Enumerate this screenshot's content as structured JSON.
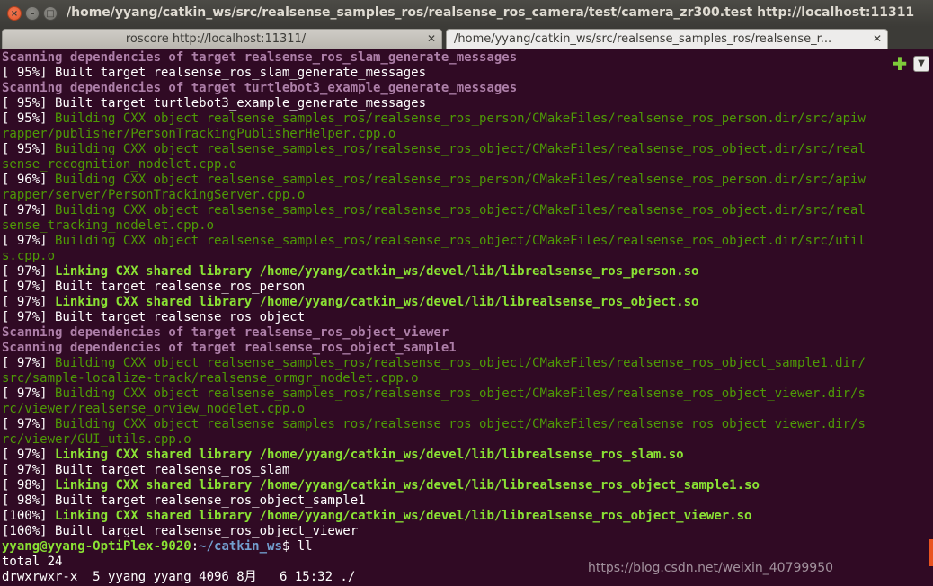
{
  "window": {
    "title": "/home/yyang/catkin_ws/src/realsense_samples_ros/realsense_ros_camera/test/camera_zr300.test http://localhost:11311"
  },
  "tabs": [
    {
      "label": "roscore http://localhost:11311/",
      "active": false
    },
    {
      "label": "/home/yyang/catkin_ws/src/realsense_samples_ros/realsense_r...",
      "active": true
    }
  ],
  "terminal": {
    "lines": [
      {
        "style": "scan",
        "text": "Scanning dependencies of target realsense_ros_slam_generate_messages"
      },
      {
        "style": "plain",
        "text": "[ 95%] Built target realsense_ros_slam_generate_messages"
      },
      {
        "style": "scan",
        "text": "Scanning dependencies of target turtlebot3_example_generate_messages"
      },
      {
        "style": "plain",
        "text": "[ 95%] Built target turtlebot3_example_generate_messages"
      },
      {
        "style": "cxx",
        "pct": "[ 95%] ",
        "text": "Building CXX object realsense_samples_ros/realsense_ros_person/CMakeFiles/realsense_ros_person.dir/src/apiw"
      },
      {
        "style": "cxx",
        "text": "rapper/publisher/PersonTrackingPublisherHelper.cpp.o"
      },
      {
        "style": "cxx",
        "pct": "[ 95%] ",
        "text": "Building CXX object realsense_samples_ros/realsense_ros_object/CMakeFiles/realsense_ros_object.dir/src/real"
      },
      {
        "style": "cxx",
        "text": "sense_recognition_nodelet.cpp.o"
      },
      {
        "style": "cxx",
        "pct": "[ 96%] ",
        "text": "Building CXX object realsense_samples_ros/realsense_ros_person/CMakeFiles/realsense_ros_person.dir/src/apiw"
      },
      {
        "style": "cxx",
        "text": "rapper/server/PersonTrackingServer.cpp.o"
      },
      {
        "style": "cxx",
        "pct": "[ 97%] ",
        "text": "Building CXX object realsense_samples_ros/realsense_ros_object/CMakeFiles/realsense_ros_object.dir/src/real"
      },
      {
        "style": "cxx",
        "text": "sense_tracking_nodelet.cpp.o"
      },
      {
        "style": "cxx",
        "pct": "[ 97%] ",
        "text": "Building CXX object realsense_samples_ros/realsense_ros_object/CMakeFiles/realsense_ros_object.dir/src/util"
      },
      {
        "style": "cxx",
        "text": "s.cpp.o"
      },
      {
        "style": "link",
        "pct": "[ 97%] ",
        "text": "Linking CXX shared library /home/yyang/catkin_ws/devel/lib/librealsense_ros_person.so"
      },
      {
        "style": "plain",
        "text": "[ 97%] Built target realsense_ros_person"
      },
      {
        "style": "link",
        "pct": "[ 97%] ",
        "text": "Linking CXX shared library /home/yyang/catkin_ws/devel/lib/librealsense_ros_object.so"
      },
      {
        "style": "plain",
        "text": "[ 97%] Built target realsense_ros_object"
      },
      {
        "style": "scan",
        "text": "Scanning dependencies of target realsense_ros_object_viewer"
      },
      {
        "style": "scan",
        "text": "Scanning dependencies of target realsense_ros_object_sample1"
      },
      {
        "style": "cxx",
        "pct": "[ 97%] ",
        "text": "Building CXX object realsense_samples_ros/realsense_ros_object/CMakeFiles/realsense_ros_object_sample1.dir/"
      },
      {
        "style": "cxx",
        "text": "src/sample-localize-track/realsense_ormgr_nodelet.cpp.o"
      },
      {
        "style": "cxx",
        "pct": "[ 97%] ",
        "text": "Building CXX object realsense_samples_ros/realsense_ros_object/CMakeFiles/realsense_ros_object_viewer.dir/s"
      },
      {
        "style": "cxx",
        "text": "rc/viewer/realsense_orview_nodelet.cpp.o"
      },
      {
        "style": "cxx",
        "pct": "[ 97%] ",
        "text": "Building CXX object realsense_samples_ros/realsense_ros_object/CMakeFiles/realsense_ros_object_viewer.dir/s"
      },
      {
        "style": "cxx",
        "text": "rc/viewer/GUI_utils.cpp.o"
      },
      {
        "style": "link",
        "pct": "[ 97%] ",
        "text": "Linking CXX shared library /home/yyang/catkin_ws/devel/lib/librealsense_ros_slam.so"
      },
      {
        "style": "plain",
        "text": "[ 97%] Built target realsense_ros_slam"
      },
      {
        "style": "link",
        "pct": "[ 98%] ",
        "text": "Linking CXX shared library /home/yyang/catkin_ws/devel/lib/librealsense_ros_object_sample1.so"
      },
      {
        "style": "plain",
        "text": "[ 98%] Built target realsense_ros_object_sample1"
      },
      {
        "style": "link",
        "pct": "[100%] ",
        "text": "Linking CXX shared library /home/yyang/catkin_ws/devel/lib/librealsense_ros_object_viewer.so"
      },
      {
        "style": "plain",
        "text": "[100%] Built target realsense_ros_object_viewer"
      }
    ],
    "prompt": {
      "user_host": "yyang@yyang-OptiPlex-9020",
      "sep": ":",
      "cwd": "~/catkin_ws",
      "symbol": "$ ",
      "command": "ll"
    },
    "after_prompt": [
      "total 24",
      "drwxrwxr-x  5 yyang yyang 4096 8月   6 15:32 ./"
    ]
  },
  "watermark": "https://blog.csdn.net/weixin_40799950",
  "colors": {
    "background": "#300a24",
    "scan": "#ad7fa8",
    "cxx": "#4e9a06",
    "link": "#8ae234",
    "path": "#729fcf",
    "accent": "#e95420"
  }
}
